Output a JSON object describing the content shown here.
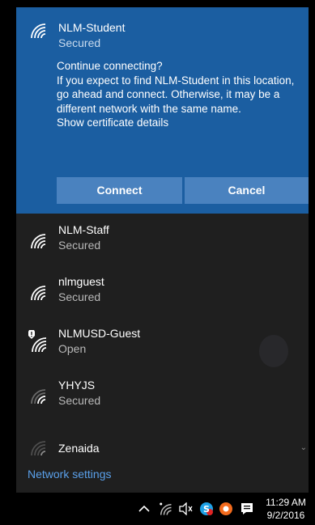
{
  "active_network": {
    "name": "NLM-Student",
    "status": "Secured",
    "prompt_title": "Continue connecting?",
    "prompt_body": "If you expect to find NLM-Student in this location, go ahead and connect. Otherwise, it may be a different network with the same name.",
    "certificate_link": "Show certificate details",
    "connect_label": "Connect",
    "cancel_label": "Cancel",
    "icon": "wifi-secured-icon"
  },
  "networks": [
    {
      "name": "NLM-Staff",
      "status": "Secured",
      "icon": "wifi-secured-icon"
    },
    {
      "name": "nlmguest",
      "status": "Secured",
      "icon": "wifi-secured-icon"
    },
    {
      "name": "NLMUSD-Guest",
      "status": "Open",
      "icon": "wifi-open-shield-icon"
    },
    {
      "name": "YHYJS",
      "status": "Secured",
      "icon": "wifi-weak-icon"
    },
    {
      "name": "Zenaida",
      "status": "",
      "icon": "wifi-weak-icon"
    }
  ],
  "network_settings_label": "Network settings",
  "taskbar": {
    "time": "11:29 AM",
    "date": "9/2/2016",
    "icons": [
      "chevron-up-icon",
      "wifi-icon",
      "volume-icon",
      "skype-icon",
      "app-icon",
      "notification-icon"
    ]
  },
  "colors": {
    "accent": "#1b5ea1",
    "button": "#4a82bf",
    "flyout_bg": "#1f1f1f",
    "link": "#5aa0ea"
  }
}
